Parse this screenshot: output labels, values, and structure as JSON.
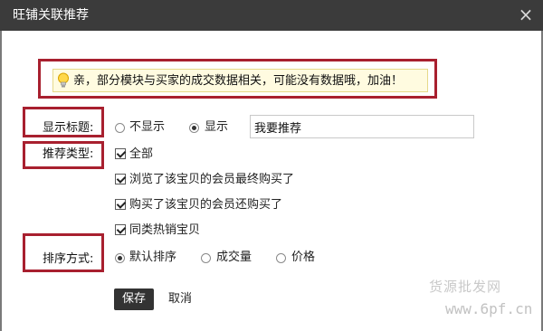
{
  "dialog": {
    "title": "旺铺关联推荐",
    "close_symbol": "×"
  },
  "tip": {
    "icon": "lightbulb-icon",
    "text": "亲，部分模块与买家的成交数据相关，可能没有数据哦，加油！"
  },
  "display_title": {
    "label": "显示标题:",
    "options": [
      {
        "label": "不显示",
        "selected": false
      },
      {
        "label": "显示",
        "selected": true
      }
    ],
    "input_value": "我要推荐"
  },
  "recommend_type": {
    "label": "推荐类型:",
    "options": [
      {
        "label": "全部",
        "checked": true
      },
      {
        "label": "浏览了该宝贝的会员最终购买了",
        "checked": true
      },
      {
        "label": "购买了该宝贝的会员还购买了",
        "checked": true
      },
      {
        "label": "同类热销宝贝",
        "checked": true
      }
    ]
  },
  "sort_method": {
    "label": "排序方式:",
    "options": [
      {
        "label": "默认排序",
        "selected": true
      },
      {
        "label": "成交量",
        "selected": false
      },
      {
        "label": "价格",
        "selected": false
      }
    ]
  },
  "actions": {
    "save": "保存",
    "cancel": "取消"
  },
  "watermark": {
    "cn": "货源批发网",
    "url": "www.6pf.cn"
  },
  "colors": {
    "titlebar": "#3b3b3b",
    "highlight_outline": "#a8202f",
    "tip_background": "#fffbe0"
  }
}
